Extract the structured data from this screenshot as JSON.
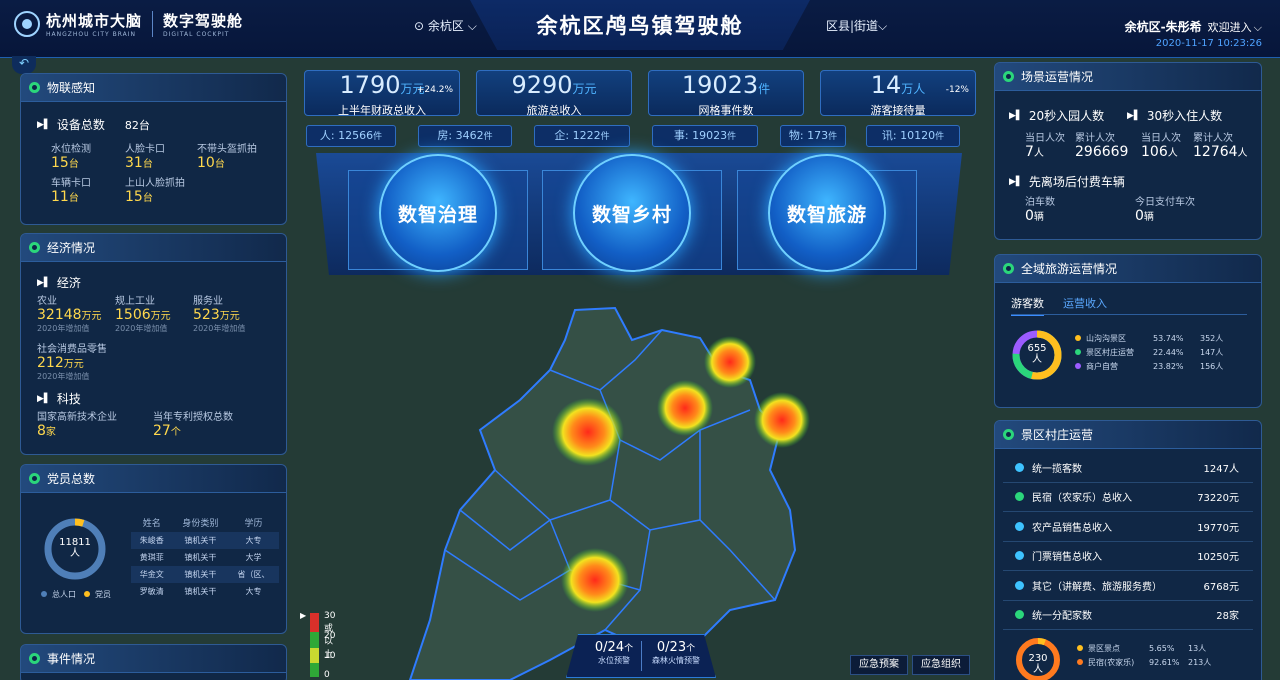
{
  "header": {
    "logo_cn": "杭州城市大脑",
    "logo_en": "HANGZHOU CITY BRAIN",
    "cockpit_cn": "数字驾驶舱",
    "cockpit_en": "DIGITAL COCKPIT",
    "district": "余杭区",
    "title": "余杭区鸬鸟镇驾驶舱",
    "county_street": "区县|街道",
    "user": "余杭区-朱彤希",
    "welcome": "欢迎进入",
    "time": "2020-11-17 10:23:26"
  },
  "iot": {
    "title": "物联感知",
    "total_label": "设备总数",
    "total": "82台",
    "items": [
      {
        "label": "水位检测",
        "num": "15",
        "unit": "台"
      },
      {
        "label": "人脸卡口",
        "num": "31",
        "unit": "台"
      },
      {
        "label": "不带头盔抓拍",
        "num": "10",
        "unit": "台"
      },
      {
        "label": "车辆卡口",
        "num": "11",
        "unit": "台"
      },
      {
        "label": "上山人脸抓拍",
        "num": "15",
        "unit": "台"
      }
    ]
  },
  "economy": {
    "title": "经济情况",
    "sec1": "经济",
    "items": [
      {
        "label": "农业",
        "num": "32148",
        "unit": "万元",
        "sub": "2020年增加值"
      },
      {
        "label": "规上工业",
        "num": "1506",
        "unit": "万元",
        "sub": "2020年增加值"
      },
      {
        "label": "服务业",
        "num": "523",
        "unit": "万元",
        "sub": "2020年增加值"
      },
      {
        "label": "社会消费品零售",
        "num": "212",
        "unit": "万元",
        "sub": "2020年增加值"
      }
    ],
    "sec2": "科技",
    "tech": [
      {
        "label": "国家高新技术企业",
        "num": "8",
        "unit": "家"
      },
      {
        "label": "当年专利授权总数",
        "num": "27",
        "unit": "个"
      }
    ]
  },
  "party": {
    "title": "党员总数",
    "total": "11811",
    "unit": "人",
    "party_share": 0.05,
    "legend": [
      "总人口",
      "党员"
    ],
    "table": {
      "headers": [
        "姓名",
        "身份类别",
        "学历"
      ],
      "rows": [
        [
          "朱峻香",
          "镇机关干",
          "大专"
        ],
        [
          "黄琪菲",
          "镇机关干",
          "大学"
        ],
        [
          "华金文",
          "镇机关干",
          "省（区、"
        ],
        [
          "罗敏清",
          "镇机关干",
          "大专"
        ]
      ]
    }
  },
  "events": {
    "title": "事件情况"
  },
  "kpis": [
    {
      "num": "1790",
      "unit": "万元",
      "label": "上半年财政总收入",
      "change": "+24.2%"
    },
    {
      "num": "9290",
      "unit": "万元",
      "label": "旅游总收入",
      "change": ""
    },
    {
      "num": "19023",
      "unit": "件",
      "label": "网格事件数",
      "change": ""
    },
    {
      "num": "14",
      "unit": "万人",
      "label": "游客接待量",
      "change": "-12%"
    }
  ],
  "pills": [
    {
      "label": "人: 12566",
      "unit": "件"
    },
    {
      "label": "房: 3462",
      "unit": "件"
    },
    {
      "label": "企: 1222",
      "unit": "件"
    },
    {
      "label": "事: 19023",
      "unit": "件"
    },
    {
      "label": "物: 173",
      "unit": "件"
    },
    {
      "label": "讯: 10120",
      "unit": "件"
    }
  ],
  "modules": [
    "数智治理",
    "数智乡村",
    "数智旅游"
  ],
  "map": {
    "legend": [
      "30或以上",
      "20",
      "10",
      "0"
    ],
    "water_warn": "0/24",
    "water_unit": "个",
    "water_label": "水位预警",
    "fire_warn": "0/23",
    "fire_unit": "个",
    "fire_label": "森林火情预警",
    "btn1": "应急预案",
    "btn2": "应急组织"
  },
  "scene": {
    "title": "场景运营情况",
    "a_title": "20秒入园人数",
    "b_title": "30秒入住人数",
    "today": "当日人次",
    "total": "累计人次",
    "a_today": "7",
    "a_total": "296669",
    "b_today": "106",
    "b_total": "12764",
    "unit": "人",
    "c_title": "先离场后付费车辆",
    "parking": "泊车数",
    "parking_val": "0",
    "paid": "今日支付车次",
    "paid_val": "0",
    "unit_car": "辆"
  },
  "tourism": {
    "title": "全域旅游运营情况",
    "tab1": "游客数",
    "tab2": "运营收入",
    "center": "655",
    "center_unit": "人",
    "items": [
      {
        "name": "山沟沟景区",
        "pct": "53.74%",
        "num": "352人",
        "color": "#ffbf1f"
      },
      {
        "name": "景区村庄运营",
        "pct": "22.44%",
        "num": "147人",
        "color": "#2bd67b"
      },
      {
        "name": "商户自营",
        "pct": "23.82%",
        "num": "156人",
        "color": "#9c5cff"
      }
    ]
  },
  "village": {
    "title": "景区村庄运营",
    "rows": [
      {
        "label": "统一揽客数",
        "value": "1247人"
      },
      {
        "label": "民宿（农家乐）总收入",
        "value": "73220元"
      },
      {
        "label": "农产品销售总收入",
        "value": "19770元"
      },
      {
        "label": "门票销售总收入",
        "value": "10250元"
      },
      {
        "label": "其它（讲解费、旅游服务费）",
        "value": "6768元"
      },
      {
        "label": "统一分配家数",
        "value": "28家"
      }
    ],
    "donut": {
      "center": "230",
      "unit": "人",
      "items": [
        {
          "name": "景区景点",
          "pct": "5.65%",
          "num": "13人",
          "color": "#ffbf1f"
        },
        {
          "name": "民宿(农家乐)",
          "pct": "92.61%",
          "num": "213人",
          "color": "#ff7a1f"
        }
      ]
    }
  }
}
